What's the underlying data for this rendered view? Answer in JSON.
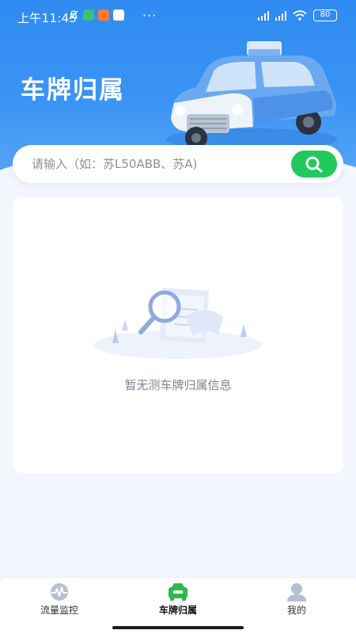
{
  "status_bar": {
    "time": "上午11:45",
    "dots": "···",
    "battery": "80"
  },
  "header": {
    "title": "车牌归属"
  },
  "search": {
    "placeholder": "请输入（如：苏L50ABB、苏A)",
    "value": ""
  },
  "result": {
    "empty_text": "暂无测车牌归属信息"
  },
  "tabs": [
    {
      "label": "流量监控",
      "icon": "pulse-icon",
      "active": false
    },
    {
      "label": "车牌归属",
      "icon": "car-icon",
      "active": true
    },
    {
      "label": "我的",
      "icon": "person-icon",
      "active": false
    }
  ],
  "colors": {
    "accent_blue": "#2f8bf1",
    "search_green": "#1fc95b",
    "active_tab_green": "#2db84d",
    "inactive_tab_icon": "#b6bfd0"
  }
}
